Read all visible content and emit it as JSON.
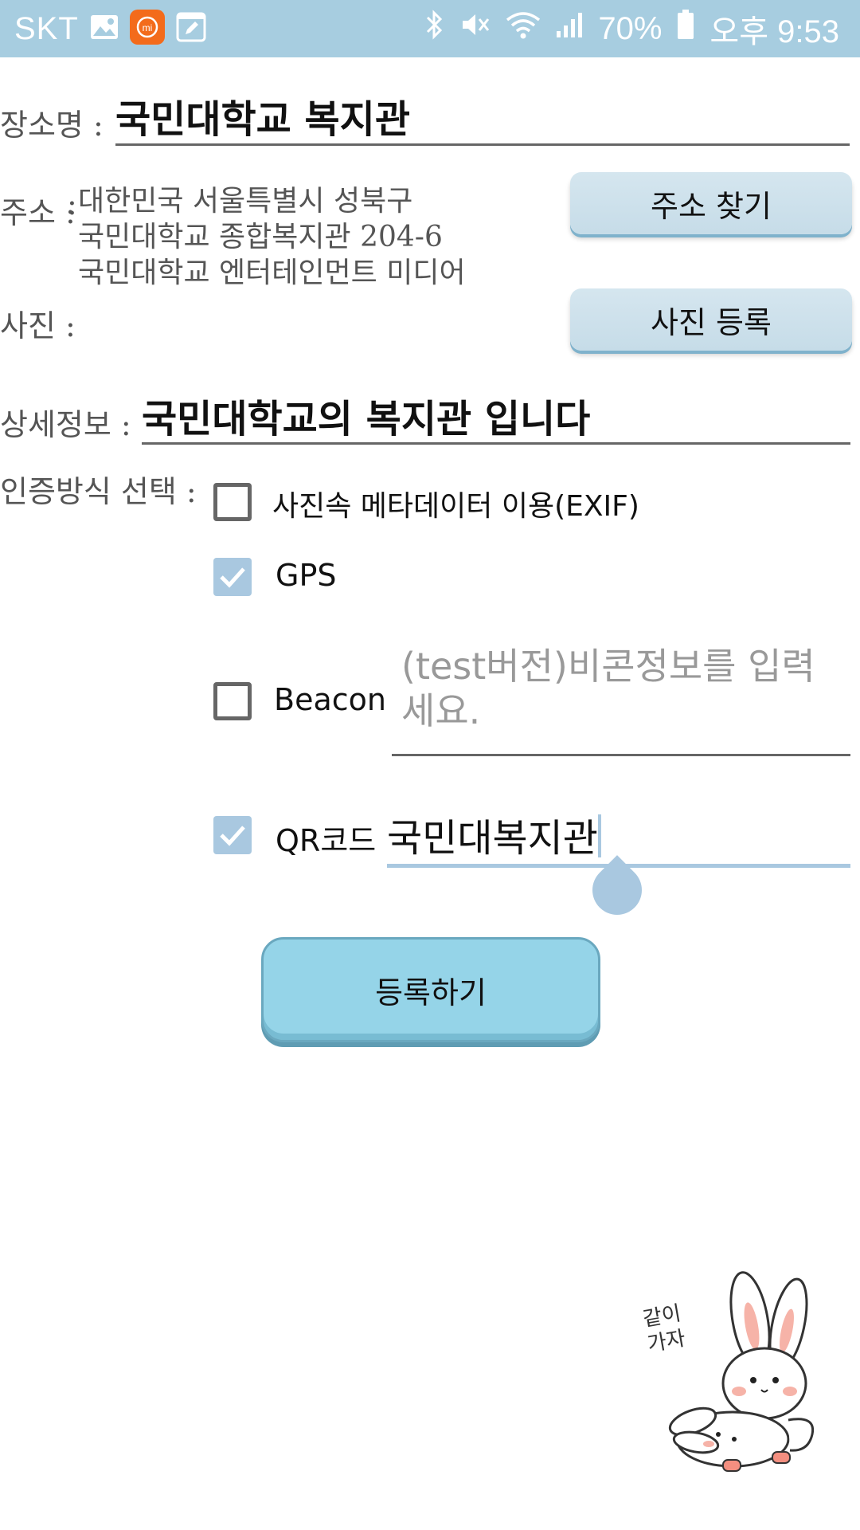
{
  "status_bar": {
    "carrier": "SKT",
    "battery": "70%",
    "time": "오후 9:53",
    "left_icons": [
      "image-icon",
      "mi-app-icon",
      "edit-icon"
    ],
    "right_icons": [
      "bluetooth-icon",
      "mute-icon",
      "wifi-icon",
      "signal-icon",
      "battery-icon"
    ]
  },
  "form": {
    "place_name": {
      "label": "장소명 :",
      "value": "국민대학교  복지관"
    },
    "address": {
      "label": "주소 :",
      "lines": [
        "대한민국 서울특별시 성북구",
        "국민대학교 종합복지관 204-6",
        "국민대학교 엔터테인먼트 미디어"
      ],
      "find_button": "주소 찾기"
    },
    "photo": {
      "label": "사진 :",
      "register_button": "사진 등록"
    },
    "detail": {
      "label": "상세정보 :",
      "value": "국민대학교의 복지관 입니다"
    },
    "auth": {
      "label": "인증방식 선택 :",
      "options": [
        {
          "label": "사진속 메타데이터 이용(EXIF)",
          "checked": false
        },
        {
          "label": "GPS",
          "checked": true
        },
        {
          "label": "Beacon",
          "checked": false,
          "input_placeholder": "(test버전)비콘정보를 입력세요."
        },
        {
          "label": "QR코드",
          "checked": true,
          "input_value": "국민대복지관"
        }
      ]
    },
    "submit_button": "등록하기"
  },
  "sticker": {
    "text": "같이 가자"
  },
  "colors": {
    "status_bar": "#a7cde0",
    "button_light": "#cfe2ec",
    "button_primary": "#95d4e8",
    "checkbox_checked": "#a9c8e0",
    "text_cursor": "#a9c8e0"
  }
}
